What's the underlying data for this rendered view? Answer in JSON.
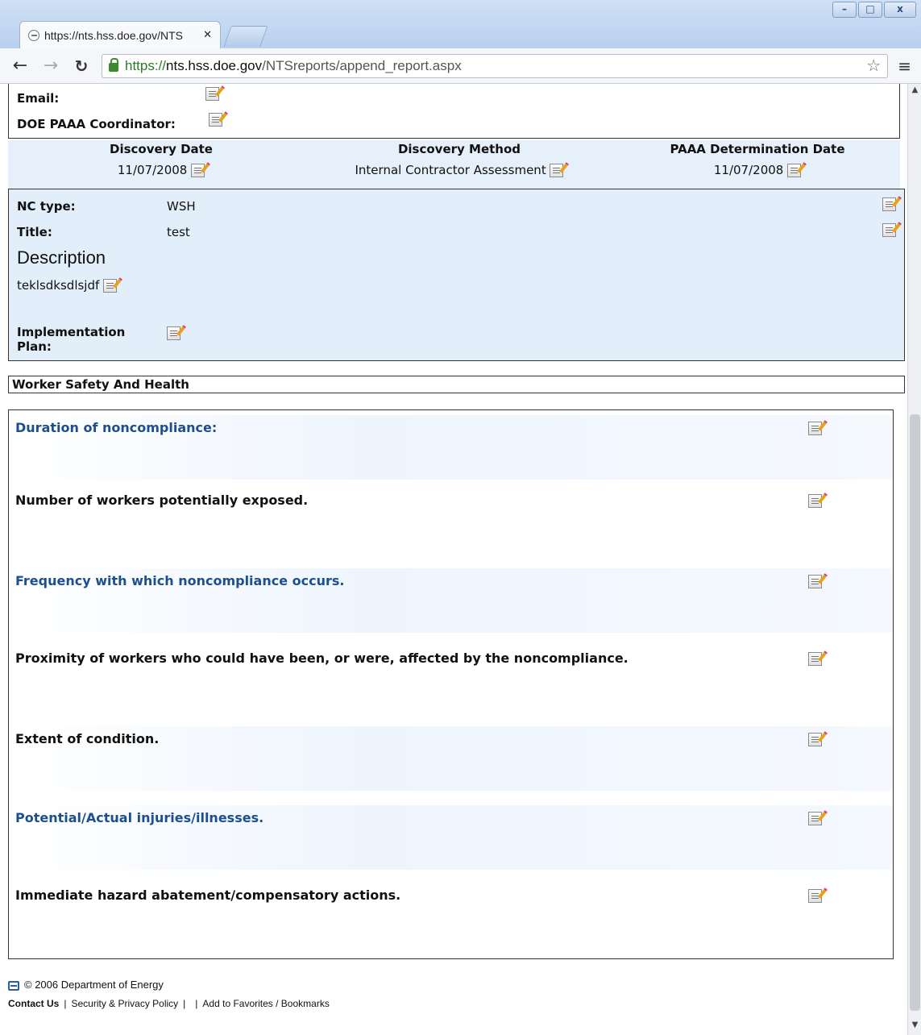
{
  "browser": {
    "tab_title": "https://nts.hss.doe.gov/NTS",
    "url_scheme": "https://",
    "url_host": "nts.hss.doe.gov",
    "url_path": "/NTSreports/append_report.aspx",
    "controls": {
      "minimize": "–",
      "maximize": "□",
      "close": "x"
    }
  },
  "contact": {
    "email_label": "Email:",
    "coordinator_label": "DOE PAAA Coordinator:"
  },
  "discovery": {
    "date_label": "Discovery Date",
    "date_value": "11/07/2008",
    "method_label": "Discovery Method",
    "method_value": "Internal Contractor Assessment",
    "paaa_label": "PAAA Determination Date",
    "paaa_value": "11/07/2008"
  },
  "nc": {
    "type_label": "NC type:",
    "type_value": "WSH",
    "title_label": "Title:",
    "title_value": "test",
    "description_heading": "Description",
    "description_text": "teklsdksdlsjdf",
    "implementation_label": "Implementation Plan:"
  },
  "category": "Worker Safety And Health",
  "criteria": [
    {
      "label": "Duration of noncompliance:"
    },
    {
      "label": "Number of workers potentially exposed."
    },
    {
      "label": "Frequency with which noncompliance occurs."
    },
    {
      "label": "Proximity of workers who could have been, or were, affected by the noncompliance."
    },
    {
      "label": "Extent of condition."
    },
    {
      "label": "Potential/Actual injuries/illnesses."
    },
    {
      "label": "Immediate hazard abatement/compensatory actions."
    }
  ],
  "footer": {
    "copyright": "© 2006 Department of Energy",
    "links": [
      "Contact Us",
      "Security & Privacy Policy",
      "Add to Favorites / Bookmarks"
    ],
    "separators": [
      "|",
      "|",
      "|"
    ]
  }
}
